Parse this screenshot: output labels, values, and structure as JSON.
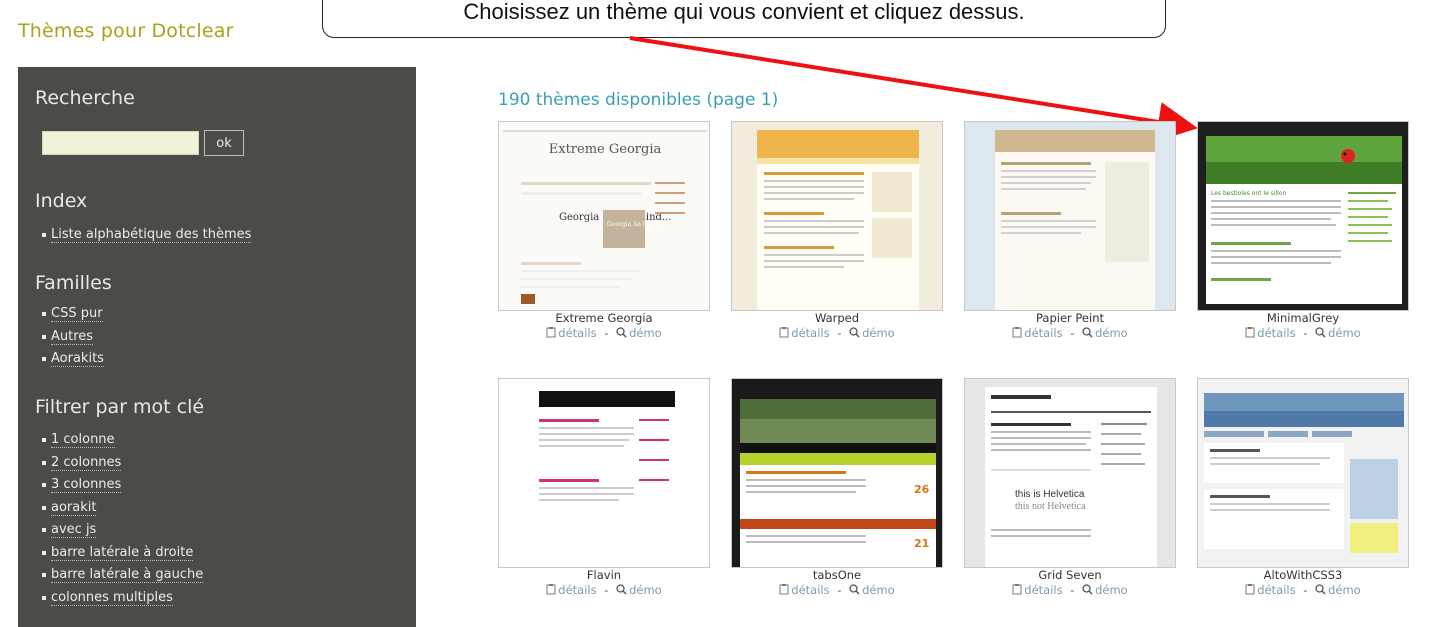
{
  "site": {
    "title": "Thèmes pour Dotclear"
  },
  "callout": {
    "text": "Choisissez un thème qui vous convient et cliquez dessus."
  },
  "sidebar": {
    "search": {
      "heading": "Recherche",
      "input_value": "",
      "button_label": "ok"
    },
    "index": {
      "heading": "Index",
      "items": [
        "Liste alphabétique des thèmes"
      ]
    },
    "families": {
      "heading": "Familles",
      "items": [
        "CSS pur",
        "Autres",
        "Aorakits"
      ]
    },
    "keywords": {
      "heading": "Filtrer par mot clé",
      "items": [
        "1 colonne",
        "2 colonnes",
        "3 colonnes",
        "aorakit",
        "avec js",
        "barre latérale à droite",
        "barre latérale à gauche",
        "colonnes multiples"
      ]
    }
  },
  "main": {
    "count_title": "190 thèmes disponibles (page 1)",
    "details_label": "détails",
    "demo_label": "démo",
    "separator": "-",
    "themes": [
      {
        "name": "Extreme Georgia",
        "preview_title": "Extreme Georgia",
        "preview_text": "Georgia on my mind...",
        "preview_box": "Georgia Aa Qq Rr",
        "accent": "#a05a2c"
      },
      {
        "name": "Warped",
        "preview_title": "",
        "accent": "#e7a93a"
      },
      {
        "name": "Papier Peint",
        "preview_title": "",
        "accent": "#c9b58a"
      },
      {
        "name": "MinimalGrey",
        "preview_title": "Les bestioles ont le sillon",
        "accent": "#1f1f1f"
      },
      {
        "name": "Flavin",
        "preview_title": "",
        "accent": "#111111"
      },
      {
        "name": "tabsOne",
        "preview_title": "",
        "preview_badge_1": "26",
        "preview_badge_2": "21",
        "accent": "#d9760e"
      },
      {
        "name": "Grid Seven",
        "preview_title": "",
        "preview_text": "this is Helvetica",
        "preview_box": "this not Helvetica",
        "accent": "#333333"
      },
      {
        "name": "AltoWithCSS3",
        "preview_title": "",
        "accent": "#4d7aa8"
      }
    ]
  },
  "colors": {
    "sidebar_bg": "#4b4c48",
    "title_olive": "#a6a31a",
    "count_teal": "#3a9fb0",
    "arrow_red": "#ee1111"
  }
}
